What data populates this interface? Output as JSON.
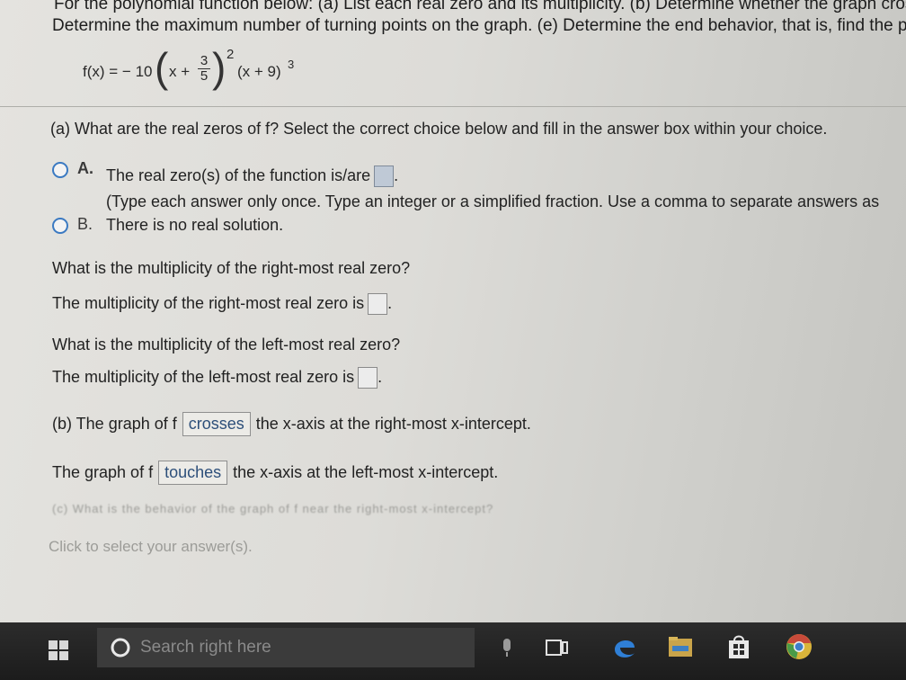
{
  "header": {
    "line1": "For the polynomial function below: (a) List each real zero and its multiplicity. (b) Determine whether the graph cross",
    "line2": "Determine the maximum number of turning points on the graph. (e) Determine the end behavior, that is, find the pow"
  },
  "function": {
    "lhs": "f(x) = − 10",
    "inner_var": "x +",
    "frac_num": "3",
    "frac_den": "5",
    "exp1": "2",
    "factor2": "(x + 9)",
    "exp2": "3"
  },
  "part_a": {
    "question": "(a) What are the real zeros of f? Select the correct choice below and fill in the answer box within your choice.",
    "option_a_letter": "A.",
    "option_a_text": "The real zero(s) of the function is/are",
    "option_a_hint": "(Type each answer only once. Type an integer or a simplified fraction. Use a comma to separate answers as",
    "option_b_letter": "B.",
    "option_b_text": "There is no real solution."
  },
  "multiplicity": {
    "right_question": "What is the multiplicity of the right-most real zero?",
    "right_answer_label": "The multiplicity of the right-most real zero is",
    "left_question": "What is the multiplicity of the left-most real zero?",
    "left_answer_label": "The multiplicity of the left-most real zero is"
  },
  "part_b": {
    "line1_prefix": "(b) The graph of f",
    "line1_dropdown": "crosses",
    "line1_suffix": "the x-axis at the right-most x-intercept.",
    "line2_prefix": "The graph of f",
    "line2_dropdown": "touches",
    "line2_suffix": "the x-axis at the left-most x-intercept."
  },
  "part_c": {
    "question": "(c) What is the behavior of the graph of f near the right-most x-intercept?",
    "select_prompt": "Click to select your answer(s)."
  },
  "taskbar": {
    "search_placeholder": "Search right here"
  },
  "colors": {
    "radio_accent": "#3b7ac2",
    "taskbar_bg": "#1c1c1c",
    "edge_blue": "#2f7fd6"
  }
}
